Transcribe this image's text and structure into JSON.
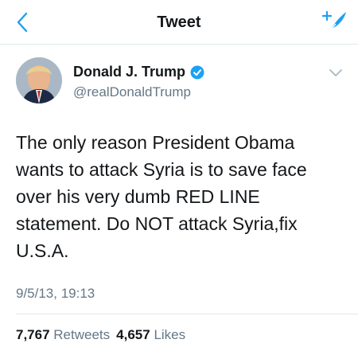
{
  "header": {
    "title": "Tweet",
    "back_icon": "chevron-left-icon",
    "compose_icon": "compose-tweet-icon",
    "accent_color": "#1da1f2"
  },
  "tweet": {
    "author": {
      "name": "Donald J. Trump",
      "handle": "@realDonaldTrump",
      "verified": true
    },
    "text": "The only reason President Obama wants to attack Syria is to save face over his very dumb RED LINE statement. Do NOT attack Syria,fix U.S.A.",
    "timestamp": "9/5/13, 19:13",
    "retweets": {
      "count": "7,767",
      "label": "Retweets"
    },
    "likes": {
      "count": "4,657",
      "label": "Likes"
    }
  }
}
